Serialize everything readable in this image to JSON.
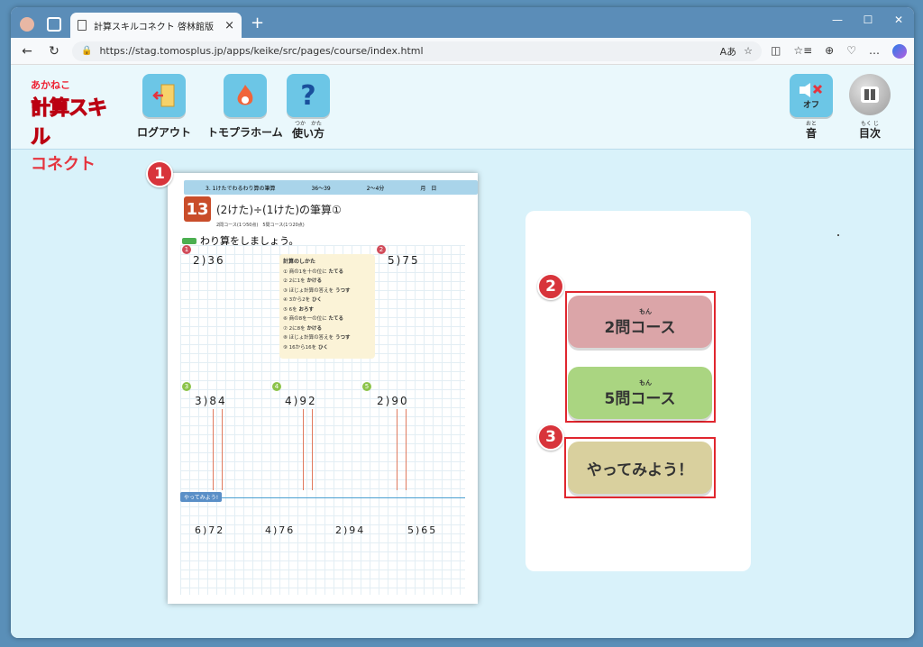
{
  "browser": {
    "tab_title": "計算スキルコネクト 啓林館版",
    "new_tab": "+",
    "tab_close": "×",
    "url": "https://stag.tomosplus.jp/apps/keike/src/pages/course/index.html",
    "window_controls": [
      "—",
      "☐",
      "✕"
    ],
    "nav": {
      "back": "←",
      "reload": "↻"
    },
    "address_right": [
      "Aあ",
      "☆",
      "◫",
      "☆≡",
      "⊕",
      "♡",
      "…"
    ]
  },
  "header": {
    "logo": {
      "line1": "あかねこ",
      "line2": "計算スキル",
      "line3": "コネクト"
    },
    "buttons": [
      {
        "label": "ログアウト",
        "icon": "logout-icon",
        "color": "#62c1e3"
      },
      {
        "label": "トモプラホーム",
        "icon": "home-flame-icon",
        "color": "#62c1e3"
      },
      {
        "label": "使い方",
        "ruby": "つか　かた",
        "icon": "question-icon",
        "color": "#62c1e3"
      }
    ],
    "sound": {
      "badge": "オフ",
      "label": "音",
      "ruby": "おと"
    },
    "toc": {
      "label": "目次",
      "ruby": "もく じ"
    }
  },
  "worksheet": {
    "band_text": "3. 1けたでわるわり算の筆算",
    "band_pages": "36〜39",
    "band_time": "2〜4分",
    "band_date": "月　日",
    "lesson_number": "13",
    "title": "(2けた)÷(1けた)の筆算①",
    "course_line": "2問コース(1つ50点)　5問コース(1つ20点)",
    "instruction": "わり算をしましょう。",
    "hint_title": "計算のしかた",
    "hint_steps": [
      {
        "text": "① 商の1を十の位に",
        "action": "たてる"
      },
      {
        "text": "② 2に1を",
        "action": "かける"
      },
      {
        "text": "③ ほじょ計算の答えを",
        "action": "うつす"
      },
      {
        "text": "④ 3から2を",
        "action": "ひく"
      },
      {
        "text": "⑤ 6を",
        "action": "おろす"
      },
      {
        "text": "⑥ 商の8を一の位に",
        "action": "たてる"
      },
      {
        "text": "⑦ 2に8を",
        "action": "かける"
      },
      {
        "text": "⑧ ほじょ計算の答えを",
        "action": "うつす"
      },
      {
        "text": "⑨ 16から16を",
        "action": "ひく"
      }
    ],
    "problems": [
      {
        "n": "1",
        "text": "2)36"
      },
      {
        "n": "2",
        "text": "5)75"
      },
      {
        "n": "3",
        "text": "3)84"
      },
      {
        "n": "4",
        "text": "4)92"
      },
      {
        "n": "5",
        "text": "2)90"
      }
    ],
    "bonus_tag": "やってみよう!",
    "bonus": [
      "6)72",
      "4)76",
      "2)94",
      "5)65"
    ]
  },
  "markers": [
    "1",
    "2",
    "3"
  ],
  "courses": {
    "two": {
      "ruby": "もん",
      "label": "2問コース",
      "color": "#d9a3a6"
    },
    "five": {
      "ruby": "もん",
      "label": "5問コース",
      "color": "#a9d47f"
    },
    "try": {
      "label": "やってみよう！",
      "color": "#d8cf9c"
    }
  }
}
